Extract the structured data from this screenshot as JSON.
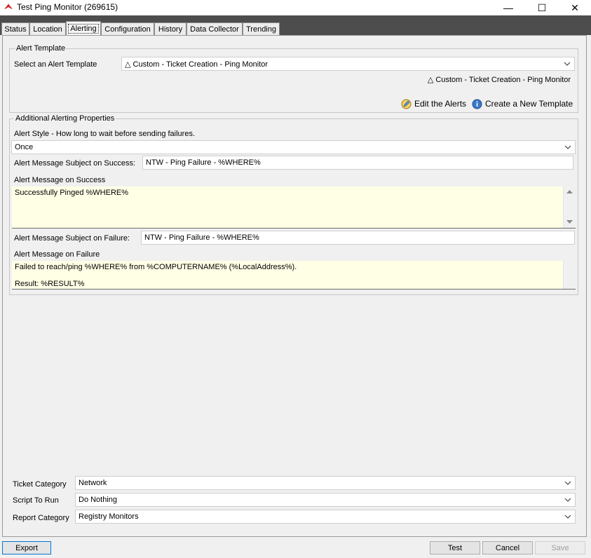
{
  "window": {
    "title": "Test Ping Monitor (269615)",
    "min_glyph": "—",
    "max_glyph": "☐",
    "close_glyph": "✕"
  },
  "tabs": [
    {
      "label": "Status"
    },
    {
      "label": "Location"
    },
    {
      "label": "Alerting",
      "active": true
    },
    {
      "label": "Configuration"
    },
    {
      "label": "History"
    },
    {
      "label": "Data Collector"
    },
    {
      "label": "Trending"
    }
  ],
  "alert_template": {
    "section_title": "Alert Template",
    "select_label": "Select an Alert Template",
    "selected_value": "△ Custom - Ticket Creation - Ping Monitor",
    "current_template_text": "△ Custom - Ticket Creation - Ping Monitor",
    "edit_alerts_label": "Edit the Alerts",
    "create_template_label": "Create a New Template"
  },
  "additional": {
    "section_title": "Additional Alerting Properties",
    "alert_style_label": "Alert Style - How long to wait before sending failures.",
    "alert_style_value": "Once",
    "success_subject_label": "Alert Message Subject on Success:",
    "success_subject_value": "NTW - Ping Failure - %WHERE%",
    "success_message_label": "Alert Message on Success",
    "success_message_value": "Successfully Pinged %WHERE%",
    "failure_subject_label": "Alert Message Subject on Failure:",
    "failure_subject_value": "NTW - Ping Failure - %WHERE%",
    "failure_message_label": "Alert Message on Failure",
    "failure_message_line1": "Failed to reach/ping %WHERE% from %COMPUTERNAME% (%LocalAddress%).",
    "failure_message_line2": "Result: %RESULT%"
  },
  "bottom_fields": {
    "ticket_category_label": "Ticket Category",
    "ticket_category_value": "Network",
    "script_label": "Script To Run",
    "script_value": "Do Nothing",
    "report_category_label": "Report Category",
    "report_category_value": "Registry Monitors"
  },
  "footer": {
    "export_label": "Export",
    "test_label": "Test",
    "cancel_label": "Cancel",
    "save_label": "Save"
  },
  "colors": {
    "textarea_bg": "#ffffe6",
    "tab_strip": "#4d4d4d",
    "primary_border": "#0078d7"
  }
}
